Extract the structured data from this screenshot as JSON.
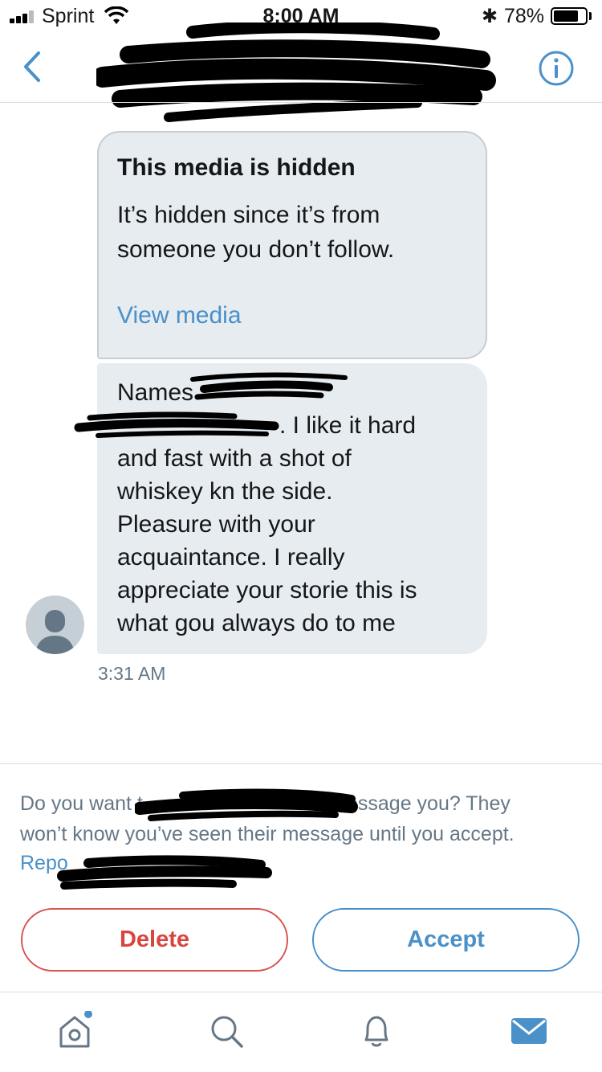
{
  "status_bar": {
    "carrier": "Sprint",
    "time": "8:00 AM",
    "battery": "78%"
  },
  "nav": {
    "back_icon": "chevron-left-icon",
    "info_icon": "info-icon"
  },
  "media_notice": {
    "title": "This media is hidden",
    "body_line1": "It’s hidden since it’s from",
    "body_line2": "someone you don’t follow.",
    "link": "View media"
  },
  "message": {
    "line1": "Names",
    "line2": ". I like it hard",
    "line3": "and fast with a shot of",
    "line4": "whiskey kn the side.",
    "line5": "Pleasure with your",
    "line6": "acquaintance. I really",
    "line7": "appreciate your storie this is",
    "line8": "what gou always do to me",
    "timestamp": "3:31 AM"
  },
  "request": {
    "line1_start": "Do you want t",
    "line1_end": "essage you? They",
    "line2": "won’t know you’ve seen their message until you accept.",
    "report_link": "Repo"
  },
  "actions": {
    "delete_label": "Delete",
    "accept_label": "Accept"
  },
  "tab_bar": {
    "items": [
      "home-icon",
      "search-icon",
      "notifications-icon",
      "messages-icon"
    ]
  },
  "colors": {
    "accent": "#4a90c9",
    "bubble": "#e6ecf0",
    "delete": "#d9443f",
    "secondary_text": "#657786"
  }
}
